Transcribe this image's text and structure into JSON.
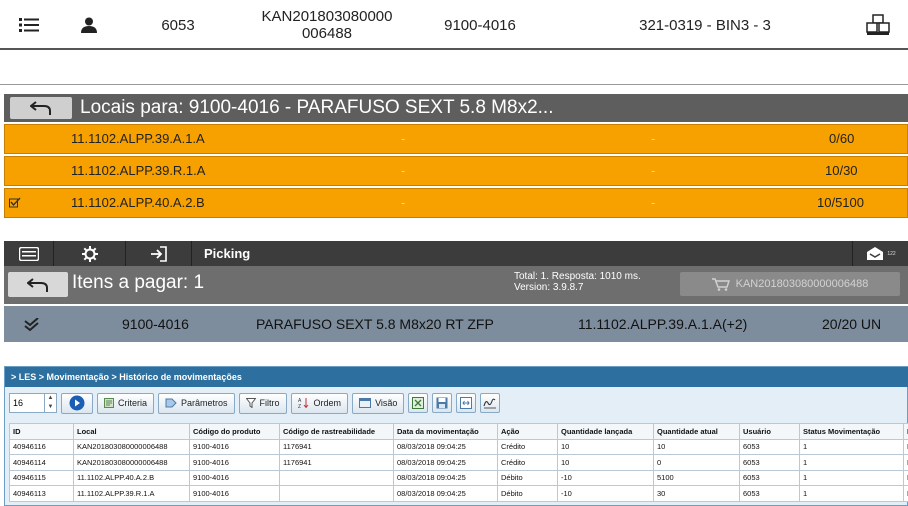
{
  "header": {
    "count": "6053",
    "doc": "KAN201803080000 006488",
    "product_code": "9100-4016",
    "location": "321-0319 - BIN3 - 3",
    "icons": [
      "list-icon",
      "user-icon",
      "boxes-icon"
    ]
  },
  "locais": {
    "title": "Locais para: 9100-4016 - PARAFUSO SEXT 5.8  M8x2...",
    "rows": [
      {
        "location": "11.1102.ALPP.39.A.1.A",
        "col2": "-",
        "col3": "-",
        "qty": "0/60",
        "checked": false
      },
      {
        "location": "11.1102.ALPP.39.R.1.A",
        "col2": "-",
        "col3": "-",
        "qty": "10/30",
        "checked": false
      },
      {
        "location": "11.1102.ALPP.40.A.2.B",
        "col2": "-",
        "col3": "-",
        "qty": "10/5100",
        "checked": true
      }
    ],
    "colors": {
      "row_bg": "#f7a100",
      "title_bg": "#5e5e5e"
    }
  },
  "picking": {
    "label": "Picking",
    "badge": "122",
    "title": "Itens a pagar: 1",
    "total": "Total: 1. Resposta: 1010 ms.",
    "version": "Version: 3.9.8.7",
    "cart_label": "KAN201803080000006488",
    "item": {
      "code": "9100-4016",
      "description": "PARAFUSO SEXT 5.8  M8x20 RT ZFP",
      "location": "11.1102.ALPP.39.A.1.A(+2)",
      "qty": "20/20 UN"
    }
  },
  "les": {
    "breadcrumb": "> LES > Movimentação > Histórico de movimentações",
    "page_size": "16",
    "toolbar": {
      "criteria": "Criteria",
      "parametros": "Parâmetros",
      "filtro": "Filtro",
      "ordem": "Ordem",
      "visao": "Visão"
    },
    "columns": [
      "ID",
      "Local",
      "Código do produto",
      "Código de rastreabilidade",
      "Data da movimentação",
      "Ação",
      "Quantidade lançada",
      "Quantidade atual",
      "Usuário",
      "Status Movimentação",
      "N"
    ],
    "rows": [
      [
        "40946116",
        "KAN201803080000006488",
        "9100-4016",
        "1176941",
        "08/03/2018 09:04:25",
        "Crédito",
        "10",
        "10",
        "6053",
        "1",
        "E"
      ],
      [
        "40946114",
        "KAN201803080000006488",
        "9100-4016",
        "1176941",
        "08/03/2018 09:04:25",
        "Crédito",
        "10",
        "0",
        "6053",
        "1",
        "E"
      ],
      [
        "40946115",
        "11.1102.ALPP.40.A.2.B",
        "9100-4016",
        "",
        "08/03/2018 09:04:25",
        "Débito",
        "-10",
        "5100",
        "6053",
        "1",
        "E"
      ],
      [
        "40946113",
        "11.1102.ALPP.39.R.1.A",
        "9100-4016",
        "",
        "08/03/2018 09:04:25",
        "Débito",
        "-10",
        "30",
        "6053",
        "1",
        "E"
      ]
    ]
  }
}
